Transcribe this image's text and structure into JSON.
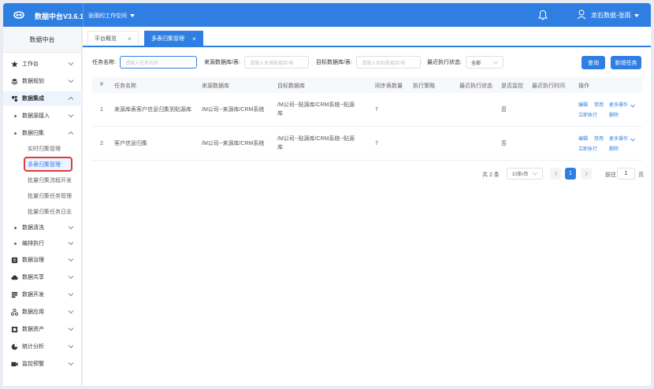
{
  "topbar": {
    "app_title": "数据中台V3.6.1",
    "workspace": "张雨的工作空间",
    "user": "龙石数据-张雨"
  },
  "sidebar": {
    "title": "数据中台",
    "items": [
      {
        "label": "工作台",
        "icon": "star-icon"
      },
      {
        "label": "数据规划",
        "icon": "layers-icon"
      },
      {
        "label": "数据集成",
        "icon": "integration-icon"
      },
      {
        "label": "数据源接入"
      },
      {
        "label": "数据归集"
      },
      {
        "label": "实时归集管理"
      },
      {
        "label": "多表归集管理"
      },
      {
        "label": "批量归集流程开发"
      },
      {
        "label": "批量归集任务管理"
      },
      {
        "label": "批量归集任务日志"
      },
      {
        "label": "数据清洗"
      },
      {
        "label": "编排执行"
      },
      {
        "label": "数据治理",
        "icon": "governance-icon"
      },
      {
        "label": "数据共享",
        "icon": "cloud-icon"
      },
      {
        "label": "数据开发",
        "icon": "develop-icon"
      },
      {
        "label": "数据应用",
        "icon": "apps-icon"
      },
      {
        "label": "数据资产",
        "icon": "asset-icon"
      },
      {
        "label": "统计分析",
        "icon": "pie-icon"
      },
      {
        "label": "监控预警",
        "icon": "monitor-icon"
      }
    ]
  },
  "tabs": [
    {
      "label": "平台概览",
      "close": "×"
    },
    {
      "label": "多表归集管理",
      "close": "×"
    }
  ],
  "filters": {
    "task_name_label": "任务名称:",
    "task_name_placeholder": "请输入任务名称",
    "source_label": "来源数据库/表:",
    "source_placeholder": "请输入来源数据库/表",
    "target_label": "目标数据库/表:",
    "target_placeholder": "请输入目标数据库/表",
    "status_label": "最近执行状态:",
    "status_value": "全部",
    "query_button": "查询",
    "new_button": "新增任务"
  },
  "table": {
    "headers": [
      "#",
      "任务名称",
      "来源数据库",
      "目标数据库",
      "同步表数量",
      "执行策略",
      "最近执行状态",
      "是否监控",
      "最近执行时间",
      "操作"
    ],
    "rows": [
      {
        "index": "1",
        "name": "来源库表客户信息归集到贴源库",
        "source": "/M公司--来源库/CRM系统",
        "target_line1": "/M公司--贴源库/CRM系统--贴源",
        "target_line2": "库",
        "table_count": "7",
        "monitor": "否"
      },
      {
        "index": "2",
        "name": "客户信息归集",
        "source": "/M公司--来源库/CRM系统",
        "target_line1": "/M公司--贴源库/CRM系统--贴源",
        "target_line2": "库",
        "table_count": "7",
        "monitor": "否"
      }
    ],
    "actions": {
      "edit": "编辑",
      "disable": "禁用",
      "more": "更多操作",
      "run_now": "立即执行",
      "delete": "删除"
    }
  },
  "pagination": {
    "total": "共 2 条",
    "page_size": "10条/页",
    "current": "1",
    "goto_label": "前往",
    "goto_value": "1",
    "goto_suffix": "页"
  },
  "colors": {
    "primary": "#2f7fe3",
    "highlight_border": "#e23b3b"
  }
}
